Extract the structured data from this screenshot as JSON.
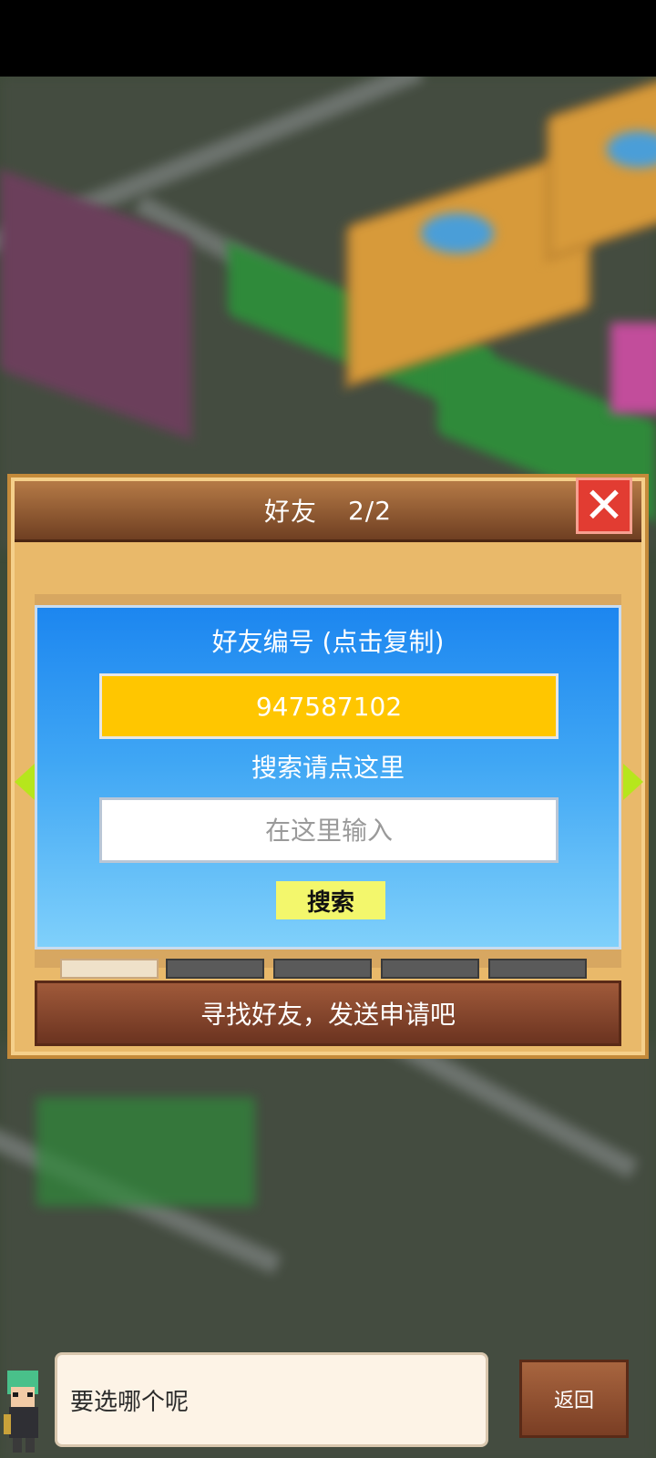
{
  "dialog": {
    "title": "好友",
    "page_indicator": "2/2"
  },
  "friend_panel": {
    "id_label": "好友编号 (点击复制)",
    "friend_id": "947587102",
    "search_label": "搜索请点这里",
    "search_placeholder": "在这里输入",
    "search_button": "搜索"
  },
  "find_friends_banner": "寻找好友，发送申请吧",
  "speech": {
    "text": "要选哪个呢"
  },
  "back_button": "返回",
  "colors": {
    "accent_yellow": "#ffc600",
    "panel_blue": "#1c86f0",
    "close_red": "#e23c32"
  }
}
